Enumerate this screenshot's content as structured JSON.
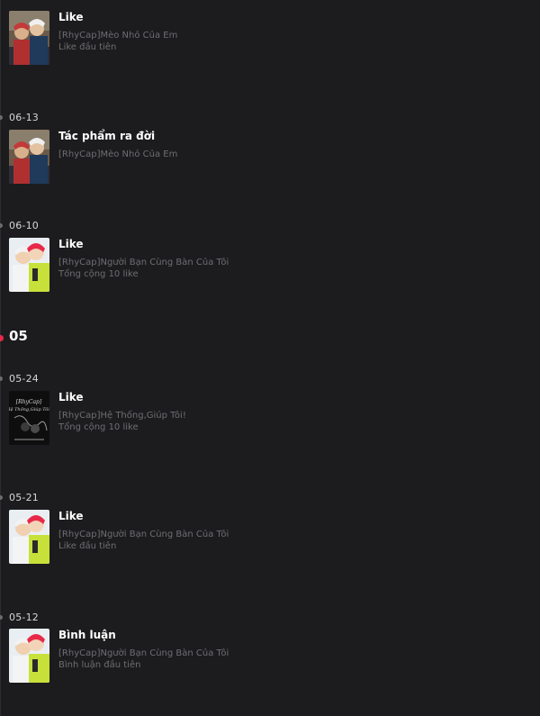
{
  "accent_color": "#e8294a",
  "entries": [
    {
      "date": "",
      "title": "Like",
      "work": "[RhyCap]Mèo Nhỏ Của Em",
      "detail": "Like đầu tiên",
      "thumb": "cover-couple-outdoor"
    },
    {
      "date": "06-13",
      "title": "Tác phẩm ra đời",
      "work": "[RhyCap]Mèo Nhỏ Của Em",
      "detail": "",
      "thumb": "cover-couple-outdoor"
    },
    {
      "date": "06-10",
      "title": "Like",
      "work": "[RhyCap]Người Bạn Cùng Bàn Của Tôi",
      "detail": "Tổng cộng 10 like",
      "thumb": "cover-red-hair-yellow"
    },
    {
      "date": "05-24",
      "title": "Like",
      "work": "[RhyCap]Hệ Thống,Giúp Tôi!",
      "detail": "Tổng cộng 10 like",
      "thumb": "cover-dark-title"
    },
    {
      "date": "05-21",
      "title": "Like",
      "work": "[RhyCap]Người Bạn Cùng Bàn Của Tôi",
      "detail": "Like đầu tiên",
      "thumb": "cover-red-hair-yellow"
    },
    {
      "date": "05-12",
      "title": "Bình luận",
      "work": "[RhyCap]Người Bạn Cùng Bàn Của Tôi",
      "detail": "Bình luận đầu tiên",
      "thumb": "cover-red-hair-yellow"
    }
  ],
  "month": "05"
}
